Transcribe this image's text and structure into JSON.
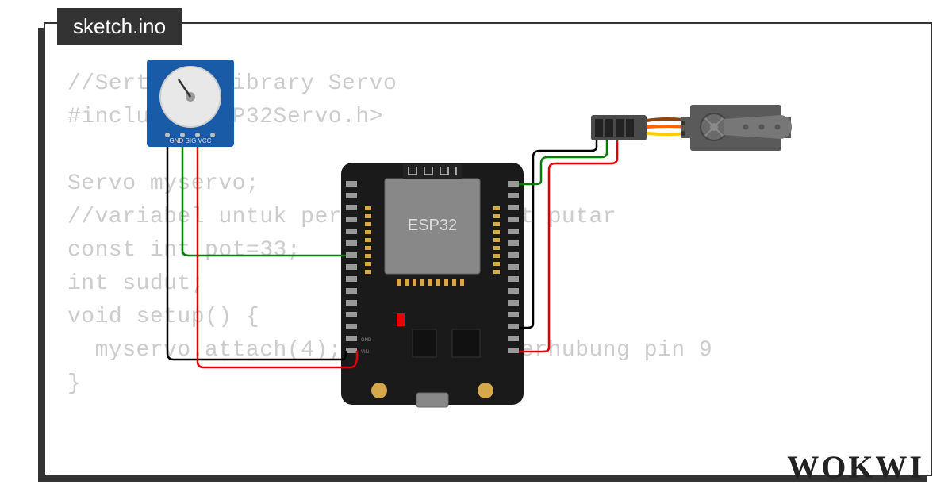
{
  "tab_title": "sketch.ino",
  "code_lines": [
    "//Sertakan library Servo",
    "#include <ESP32Servo.h>",
    "",
    "Servo myservo;",
    "//variabel untuk perhitungan sudut putar",
    "const int pot=33;",
    "int sudut;",
    "void setup() {",
    "  myservo.attach(4);   // servo terhubung pin 9",
    "}"
  ],
  "logo_text": "WOKWI",
  "components": {
    "potentiometer": {
      "label": "GND SIG VCC",
      "type": "potentiometer-breakout"
    },
    "esp32": {
      "label": "ESP32",
      "type": "esp32-devkit"
    },
    "servo": {
      "type": "servo-motor"
    }
  },
  "wires": [
    {
      "from": "pot.GND",
      "to": "esp32.GND",
      "color": "#000000"
    },
    {
      "from": "pot.SIG",
      "to": "esp32.D33",
      "color": "#008000"
    },
    {
      "from": "pot.VCC",
      "to": "esp32.VIN",
      "color": "#ff0000"
    },
    {
      "from": "servo.GND",
      "to": "esp32.GND2",
      "color": "#000000"
    },
    {
      "from": "servo.SIG",
      "to": "esp32.D4",
      "color": "#008000"
    },
    {
      "from": "servo.VCC",
      "to": "esp32.3V3",
      "color": "#ff0000"
    }
  ]
}
